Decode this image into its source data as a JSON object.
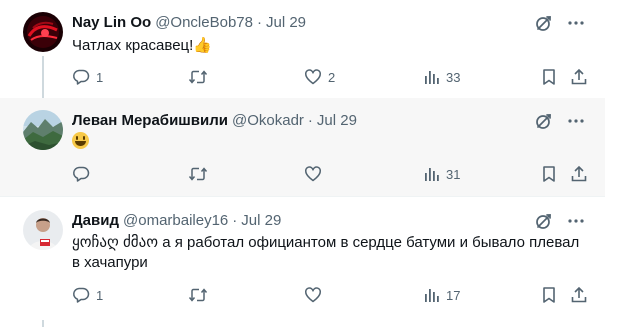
{
  "tweets": [
    {
      "name": "Nay Lin Oo",
      "handle": "@OncleBob78",
      "separator": "·",
      "date": "Jul 29",
      "text": "Чатлах красавец!",
      "emoji": "👍",
      "reply_count": "1",
      "retweet_count": "",
      "like_count": "2",
      "view_count": "33"
    },
    {
      "name": "Леван Мерабишвили",
      "handle": "@Okokadr",
      "separator": "·",
      "date": "Jul 29",
      "text": "",
      "emoji": "😃",
      "reply_count": "",
      "retweet_count": "",
      "like_count": "",
      "view_count": "31"
    },
    {
      "name": "Давид",
      "handle": "@omarbailey16",
      "separator": "·",
      "date": "Jul 29",
      "text": "ყოჩაღ ძმაო а я работал официантом в сердце батуми и бывало плевал в хачапури",
      "emoji": "",
      "reply_count": "1",
      "retweet_count": "",
      "like_count": "",
      "view_count": "17"
    }
  ],
  "icons": {
    "grok": "grok-icon",
    "more": "more-icon",
    "reply": "reply-icon",
    "retweet": "retweet-icon",
    "like": "like-icon",
    "views": "views-icon",
    "bookmark": "bookmark-icon",
    "share": "share-icon"
  },
  "colors": {
    "text": "#0f1419",
    "secondary": "#536471",
    "hover_background": "#f7f7f7",
    "thread_line": "#cfd9de"
  }
}
